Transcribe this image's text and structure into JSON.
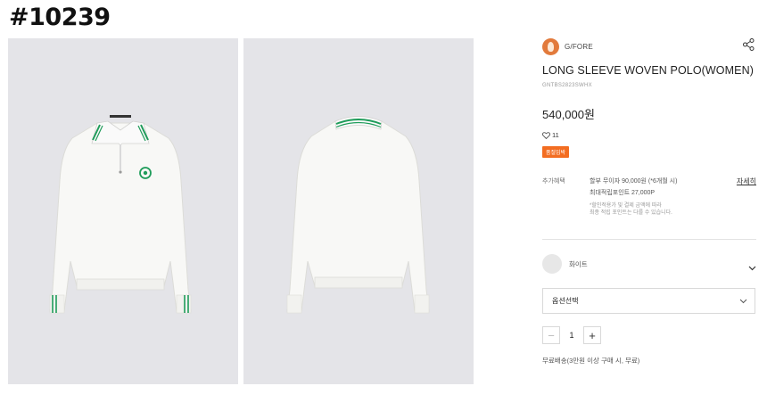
{
  "overlay_tag": "#10239",
  "product": {
    "brand": "G/FORE",
    "title": "LONG SLEEVE WOVEN POLO(WOMEN)",
    "code": "GNTBS2823SWHX",
    "price": "540,000원",
    "likes": "11",
    "badge": "품절임박"
  },
  "benefit": {
    "label": "추가혜택",
    "line1": "할부 무이자 90,000원 (*6개월 시)",
    "line2": "최대적립포인트 27,000P",
    "note1": "*할인적용가 및 결제 금액에 따라",
    "note2": "최종 적립 포인트는 다를 수 있습니다.",
    "detail_link": "자세히"
  },
  "color_option": {
    "name": "화이트",
    "swatch_color": "#e7e7e7"
  },
  "option_select": {
    "placeholder": "옵션선택"
  },
  "quantity": {
    "minus": "−",
    "value": "1",
    "plus": "+"
  },
  "shipping": "무료배송(3만원 이상 구매 시, 무료)",
  "colors": {
    "badge": "#f36d21",
    "trim_green": "#1f9c5a",
    "photo_bg": "#e4e4e8"
  },
  "icons": [
    "share-icon",
    "heart-icon",
    "chevron-down-icon"
  ]
}
